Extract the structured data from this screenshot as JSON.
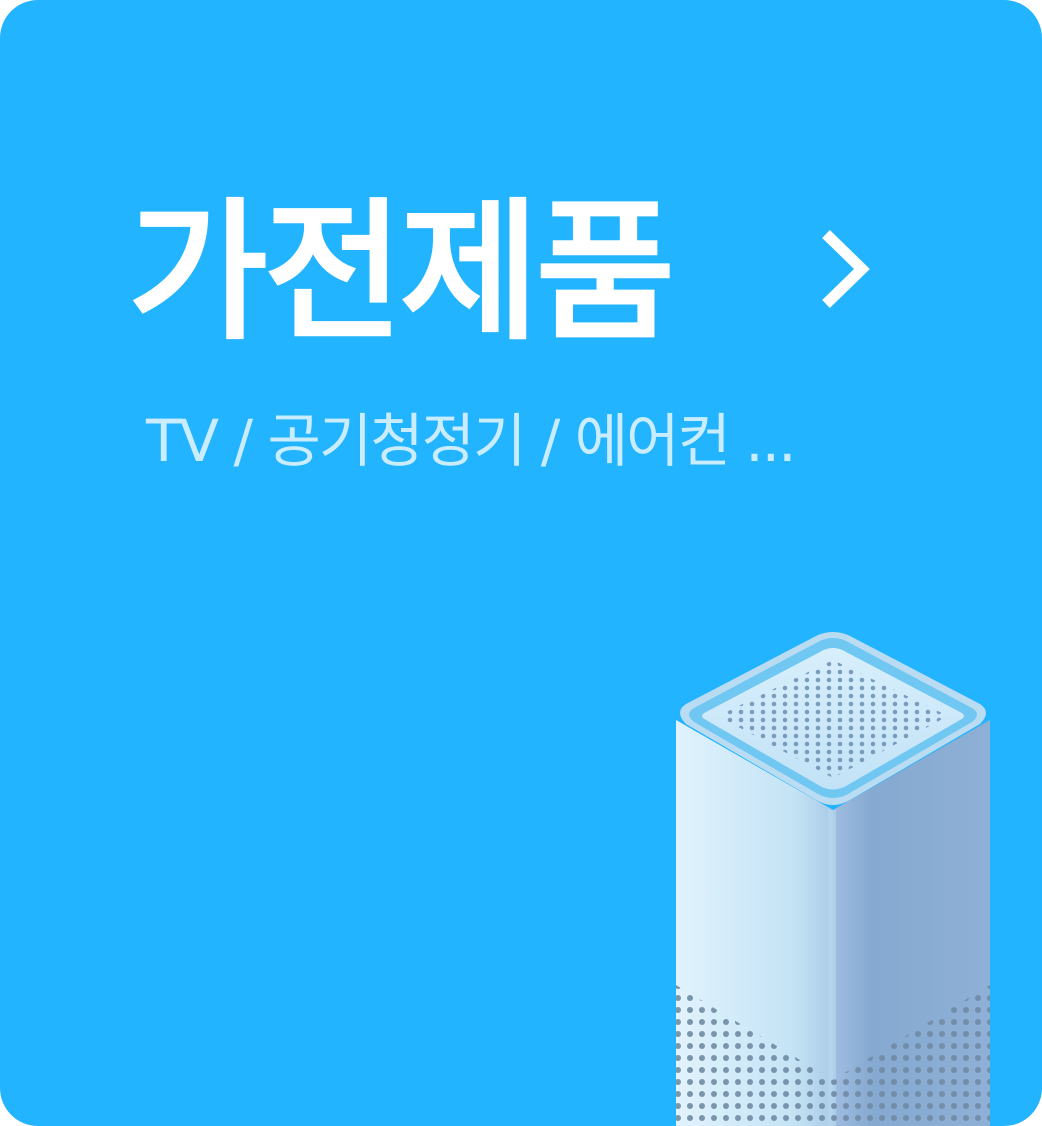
{
  "card": {
    "title": "가전제품",
    "subtitle": "TV / 공기청정기 / 에어컨 ...",
    "arrow_icon": "chevron-right-icon",
    "illustration_icon": "air-purifier-icon"
  },
  "colors": {
    "background": "#22b4ff",
    "title": "#ffffff",
    "subtitle": "#c9ecff"
  }
}
